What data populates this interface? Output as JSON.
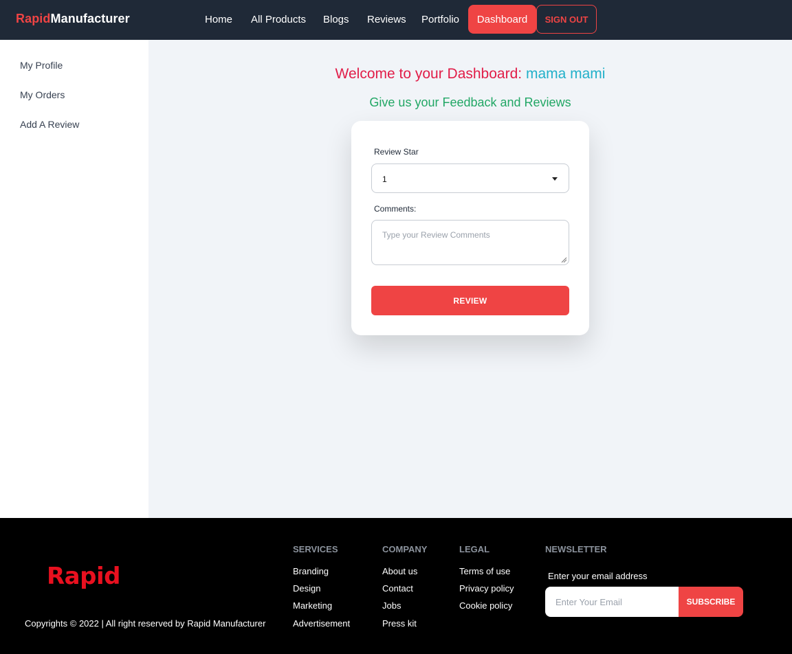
{
  "brand": {
    "part1": "Rapid",
    "part2": "Manufacturer"
  },
  "nav": {
    "items": [
      "Home",
      "All Products",
      "Blogs",
      "Reviews",
      "Portfolio"
    ],
    "dashboard": "Dashboard",
    "signout": "SIGN OUT"
  },
  "sidebar": {
    "items": [
      "My Profile",
      "My Orders",
      "Add A Review"
    ]
  },
  "main": {
    "welcome_prefix": "Welcome to your Dashboard: ",
    "user_name": "mama mami",
    "feedback_title": "Give us your Feedback and Reviews",
    "review_star_label": "Review Star",
    "review_star_value": "1",
    "comments_label": "Comments:",
    "comments_placeholder": "Type your Review Comments",
    "submit_label": "REVIEW"
  },
  "footer": {
    "logo_text": "Rapid",
    "copyright": "Copyrights © 2022 | All right reserved by Rapid Manufacturer",
    "columns": [
      {
        "heading": "SERVICES",
        "links": [
          "Branding",
          "Design",
          "Marketing",
          "Advertisement"
        ]
      },
      {
        "heading": "COMPANY",
        "links": [
          "About us",
          "Contact",
          "Jobs",
          "Press kit"
        ]
      },
      {
        "heading": "LEGAL",
        "links": [
          "Terms of use",
          "Privacy policy",
          "Cookie policy"
        ]
      }
    ],
    "newsletter": {
      "heading": "NEWSLETTER",
      "label": "Enter your email address",
      "placeholder": "Enter Your Email",
      "button": "SUBSCRIBE"
    }
  },
  "colors": {
    "accent": "#ef4444",
    "navbar": "#1f2937",
    "welcome": "#e11d48",
    "username": "#22b0c9",
    "feedback": "#22a765"
  }
}
